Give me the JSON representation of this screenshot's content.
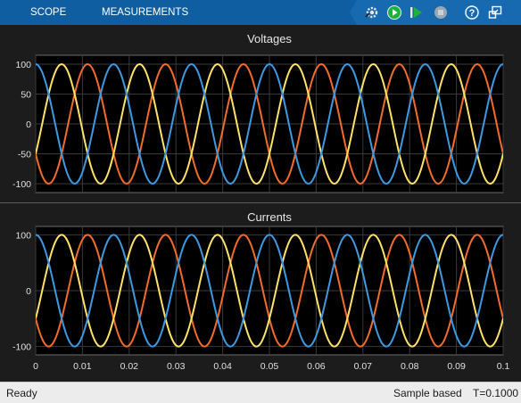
{
  "toolbar": {
    "tabs": [
      "SCOPE",
      "MEASUREMENTS"
    ],
    "icons": [
      "settings-gear-icon",
      "run-icon",
      "step-forward-icon",
      "stop-icon",
      "help-icon",
      "undock-icon"
    ],
    "colors": {
      "toolbar_bg": "#0f5ea1",
      "iconbar_bg": "#1769b0",
      "run_green": "#1bb33c"
    }
  },
  "status": {
    "ready": "Ready",
    "mode": "Sample based",
    "time": "T=0.1000"
  },
  "chart_data": [
    {
      "type": "line",
      "title": "Voltages",
      "xlim": [
        0,
        0.1
      ],
      "ylim": [
        -115,
        115
      ],
      "yticks": [
        100,
        50,
        0,
        -50,
        -100
      ],
      "grid": true,
      "frequency_hz": 60,
      "background": "#000000",
      "series": [
        {
          "amplitude": 100,
          "phase_deg": 240,
          "color": "#f26c2b"
        },
        {
          "amplitude": 100,
          "phase_deg": 120,
          "color": "#ffe268"
        },
        {
          "amplitude": 100,
          "phase_deg": 0,
          "color": "#3d9ae0"
        }
      ]
    },
    {
      "type": "line",
      "title": "Currents",
      "xlim": [
        0,
        0.1
      ],
      "ylim": [
        -115,
        115
      ],
      "yticks": [
        100,
        0,
        -100
      ],
      "xticks": [
        "0",
        "0.01",
        "0.02",
        "0.03",
        "0.04",
        "0.05",
        "0.06",
        "0.07",
        "0.08",
        "0.09",
        "0.1"
      ],
      "grid": true,
      "frequency_hz": 60,
      "background": "#000000",
      "series": [
        {
          "amplitude": 100,
          "phase_deg": 240,
          "color": "#f26c2b"
        },
        {
          "amplitude": 100,
          "phase_deg": 120,
          "color": "#ffe268"
        },
        {
          "amplitude": 100,
          "phase_deg": 0,
          "color": "#3d9ae0"
        }
      ]
    }
  ]
}
